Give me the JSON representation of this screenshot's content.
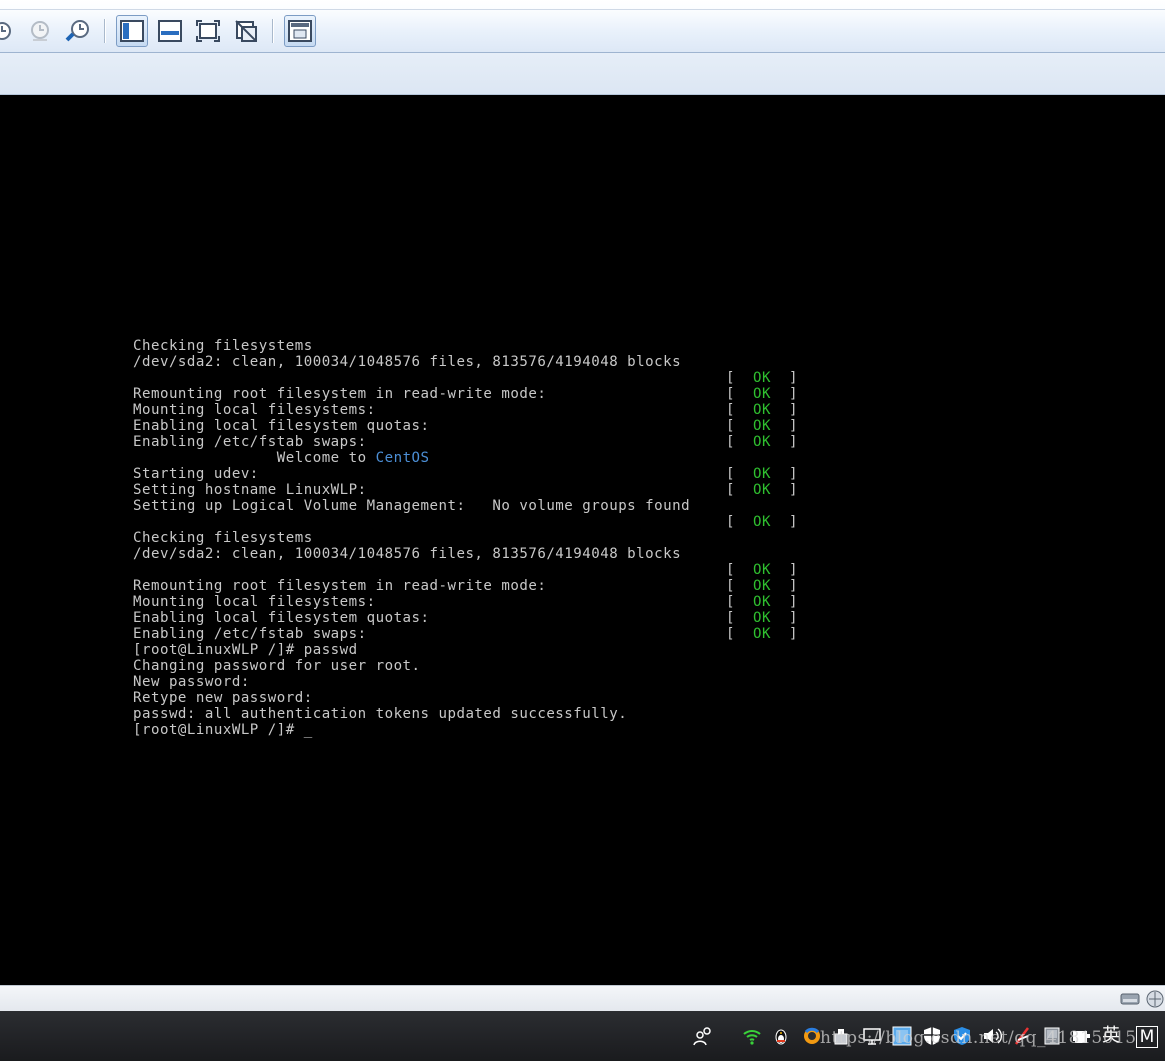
{
  "toolbar": {
    "buttons": [
      {
        "icon": "snapshot-clock-icon"
      },
      {
        "icon": "snapshot-restore-icon"
      },
      {
        "icon": "snapshot-manager-icon"
      },
      {
        "icon": "view-sidebar-icon",
        "active": true
      },
      {
        "icon": "view-console-icon"
      },
      {
        "icon": "fullscreen-icon"
      },
      {
        "icon": "unity-mode-icon"
      },
      {
        "icon": "view-tabs-icon",
        "active": true
      }
    ]
  },
  "terminal": {
    "lines": [
      {
        "text": "Checking filesystems"
      },
      {
        "text": "/dev/sda2: clean, 100034/1048576 files, 813576/4194048 blocks"
      },
      {
        "text": "",
        "ok": true
      },
      {
        "text": "Remounting root filesystem in read-write mode:",
        "ok": true
      },
      {
        "text": "Mounting local filesystems:",
        "ok": true
      },
      {
        "text": "Enabling local filesystem quotas:",
        "ok": true
      },
      {
        "text": "Enabling /etc/fstab swaps:",
        "ok": true
      },
      {
        "text": "                Welcome to ",
        "distro": "CentOS"
      },
      {
        "text": "Starting udev:",
        "ok": true
      },
      {
        "text": "Setting hostname LinuxWLP:",
        "ok": true
      },
      {
        "text": "Setting up Logical Volume Management:   No volume groups found"
      },
      {
        "text": "",
        "ok": true
      },
      {
        "text": "Checking filesystems"
      },
      {
        "text": "/dev/sda2: clean, 100034/1048576 files, 813576/4194048 blocks"
      },
      {
        "text": "",
        "ok": true
      },
      {
        "text": "Remounting root filesystem in read-write mode:",
        "ok": true
      },
      {
        "text": "Mounting local filesystems:",
        "ok": true
      },
      {
        "text": "Enabling local filesystem quotas:",
        "ok": true
      },
      {
        "text": "Enabling /etc/fstab swaps:",
        "ok": true
      },
      {
        "text": "[root@LinuxWLP /]# passwd"
      },
      {
        "text": "Changing password for user root."
      },
      {
        "text": "New password:"
      },
      {
        "text": "Retype new password:"
      },
      {
        "text": "passwd: all authentication tokens updated successfully."
      },
      {
        "text": "[root@LinuxWLP /]# ",
        "cursor": "_"
      }
    ],
    "ok_label": "OK",
    "ok_open": "[",
    "ok_close": "]"
  },
  "statusbar": {
    "icons": [
      "hard-disk-icon",
      "network-adapter-icon"
    ]
  },
  "taskbar": {
    "tray": [
      "people-icon",
      "wifi-icon",
      "qq-penguin-icon",
      "browser-icon",
      "usb-device-icon",
      "display-icon",
      "vmware-icon",
      "shield-icon",
      "security-shield-icon",
      "volume-icon",
      "flag-icon",
      "disk-icon",
      "battery-icon"
    ],
    "ime_label": "英",
    "ime_mode_label": "M"
  },
  "watermark": "https://blog.csdn.net/qq_41815015"
}
